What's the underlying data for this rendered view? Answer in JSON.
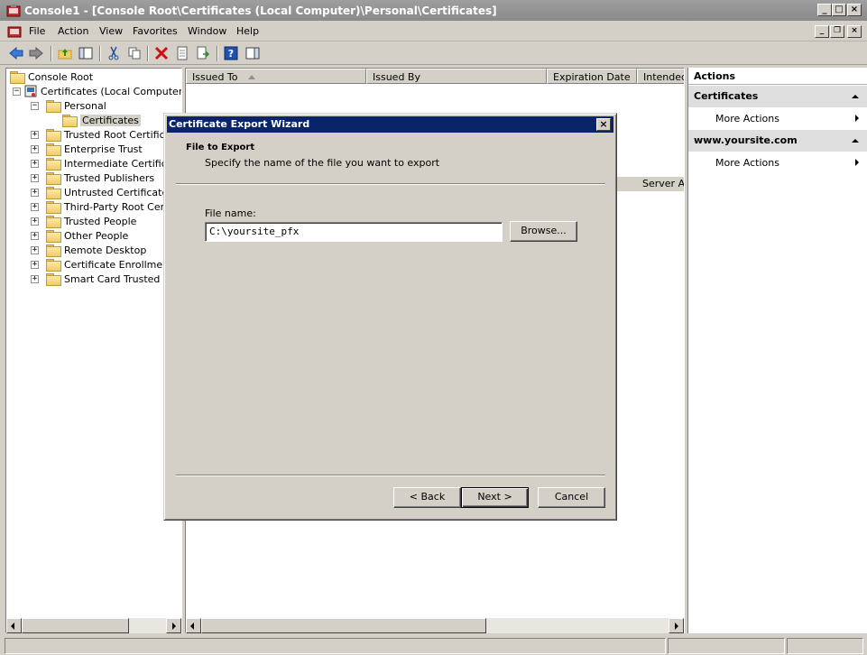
{
  "window": {
    "title": "Console1 - [Console Root\\Certificates (Local Computer)\\Personal\\Certificates]"
  },
  "menu": [
    "File",
    "Action",
    "View",
    "Favorites",
    "Window",
    "Help"
  ],
  "toolbar": {
    "icons": [
      "back-arrow-icon",
      "forward-arrow-icon",
      "up-folder-icon",
      "show-hide-tree-icon",
      "cut-icon",
      "copy-icon",
      "delete-icon",
      "properties-icon",
      "export-list-icon",
      "help-icon",
      "show-action-pane-icon"
    ]
  },
  "tree": {
    "root": "Console Root",
    "computer": "Certificates (Local Computer)",
    "personal": "Personal",
    "certificates": "Certificates",
    "stores": [
      "Trusted Root Certificati",
      "Enterprise Trust",
      "Intermediate Certificati",
      "Trusted Publishers",
      "Untrusted Certificates",
      "Third-Party Root Certifi",
      "Trusted People",
      "Other People",
      "Remote Desktop",
      "Certificate Enrollment R",
      "Smart Card Trusted Roo"
    ]
  },
  "list": {
    "columns": [
      "Issued To",
      "Issued By",
      "Expiration Date",
      "Intended"
    ],
    "row_partial": "Server Au"
  },
  "actions": {
    "header": "Actions",
    "sections": [
      {
        "title": "Certificates",
        "item": "More Actions"
      },
      {
        "title": "www.yoursite.com",
        "item": "More Actions"
      }
    ]
  },
  "dialog": {
    "title": "Certificate Export Wizard",
    "header_title": "File to Export",
    "header_subtitle": "Specify the name of the file you want to export",
    "file_label": "File name:",
    "file_value": "C:\\yoursite_pfx",
    "browse_label": "Browse...",
    "back_label": "< Back",
    "next_label": "Next >",
    "cancel_label": "Cancel"
  },
  "colors": {
    "dialog_titlebar": "#0a246a",
    "window_titlebar": "#8a8a8a",
    "face": "#d4d0c8"
  }
}
